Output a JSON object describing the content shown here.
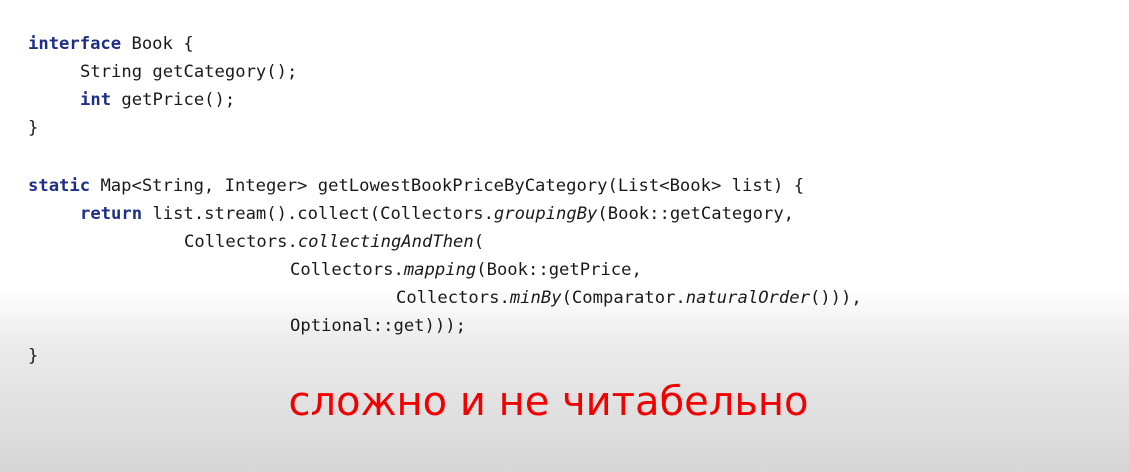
{
  "code": {
    "l1": {
      "kw": "interface",
      "rest": " Book {"
    },
    "l2": {
      "text": "String getCategory();"
    },
    "l3": {
      "kw": "int",
      "rest": " getPrice();"
    },
    "l4": {
      "text": "}"
    },
    "l6": {
      "kw": "static",
      "rest": " Map<String, Integer> getLowestBookPriceByCategory(List<Book> list) {"
    },
    "l7": {
      "kw": "return",
      "a": " list.stream().collect(Collectors.",
      "it": "groupingBy",
      "b": "(Book::getCategory,"
    },
    "l8": {
      "a": "Collectors.",
      "it": "collectingAndThen",
      "b": "("
    },
    "l9": {
      "a": "Collectors.",
      "it": "mapping",
      "b": "(Book::getPrice,"
    },
    "l10": {
      "a": "Collectors.",
      "it1": "minBy",
      "b": "(Comparator.",
      "it2": "naturalOrder",
      "c": "())),"
    },
    "l11": {
      "text": "Optional::get)));"
    },
    "l12": {
      "text": "}"
    }
  },
  "caption": "сложно и не читабельно"
}
